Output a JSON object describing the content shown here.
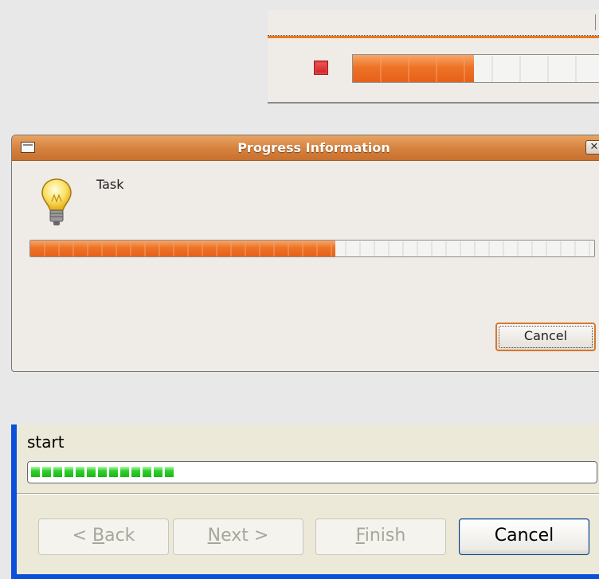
{
  "status_bar": {
    "stop_icon": "stop-icon",
    "progress_percent": 46,
    "accent_color": "#e8781f"
  },
  "progress_dialog": {
    "title": "Progress Information",
    "icon": "lightbulb-icon",
    "task_label": "Task",
    "progress_percent": 54,
    "cancel_label": "Cancel",
    "title_bar_color": "#d5813d"
  },
  "wizard": {
    "status_text": "start",
    "progress_blocks": 13,
    "back_label": "< Back",
    "next_label": "Next >",
    "finish_label": "Finish",
    "cancel_label": "Cancel",
    "frame_color": "#0a50d8",
    "progress_color": "#2fd22c"
  }
}
